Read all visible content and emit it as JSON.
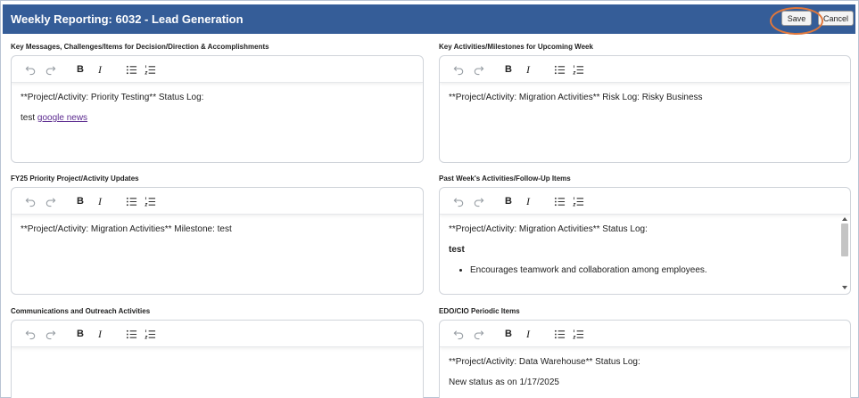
{
  "header": {
    "title": "Weekly Reporting: 6032 - Lead Generation",
    "save_label": "Save",
    "cancel_label": "Cancel"
  },
  "sections": [
    {
      "label": "Key Messages, Challenges/Items for Decision/Direction & Accomplishments",
      "lines": [
        "**Project/Activity: Priority Testing** Status Log:"
      ],
      "text_prefix": "test ",
      "link_text": "google news"
    },
    {
      "label": "Key Activities/Milestones for Upcoming Week",
      "lines": [
        "**Project/Activity: Migration Activities** Risk Log: Risky Business"
      ]
    },
    {
      "label": "FY25 Priority Project/Activity Updates",
      "lines": [
        "**Project/Activity: Migration Activities** Milestone: test"
      ]
    },
    {
      "label": "Past Week's Activities/Follow-Up Items",
      "lines": [
        "**Project/Activity: Migration Activities** Status Log:"
      ],
      "bold_line": "test",
      "bullets": [
        "Encourages teamwork and collaboration among employees."
      ]
    },
    {
      "label": "Communications and Outreach Activities",
      "lines": []
    },
    {
      "label": "EDO/CIO Periodic Items",
      "lines": [
        "**Project/Activity: Data Warehouse** Status Log:",
        "New status as on 1/17/2025"
      ]
    }
  ],
  "toolbar": {
    "icons": [
      "undo-icon",
      "redo-icon",
      "bold-icon",
      "italic-icon",
      "bullet-list-icon",
      "numbered-list-icon"
    ],
    "bold_glyph": "B",
    "italic_glyph": "I"
  },
  "colors": {
    "header_bg": "#355d98",
    "highlight_ring": "#e0773b",
    "link": "#5b2a8f"
  }
}
